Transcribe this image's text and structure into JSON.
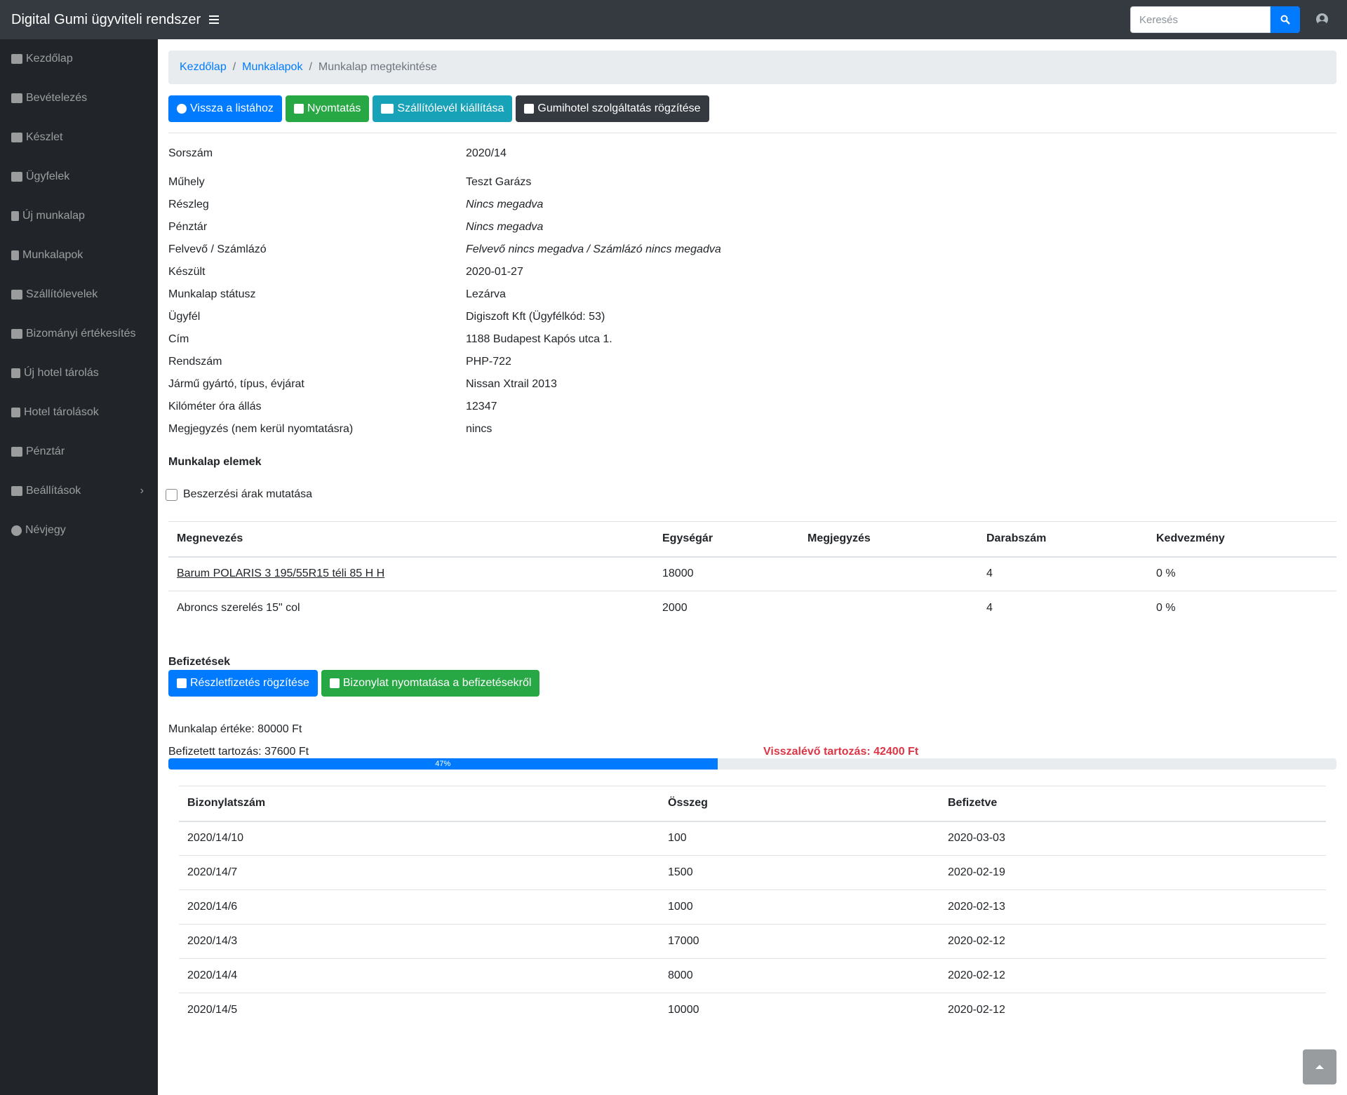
{
  "app": {
    "title": "Digital Gumi ügyviteli rendszer"
  },
  "search": {
    "placeholder": "Keresés"
  },
  "sidebar": {
    "items": [
      {
        "label": "Kezdőlap",
        "icon": "dashboard-icon"
      },
      {
        "label": "Bevételezés",
        "icon": "cubes-icon"
      },
      {
        "label": "Készlet",
        "icon": "warehouse-icon"
      },
      {
        "label": "Ügyfelek",
        "icon": "users-icon"
      },
      {
        "label": "Új munkalap",
        "icon": "file-icon"
      },
      {
        "label": "Munkalapok",
        "icon": "file-text-icon"
      },
      {
        "label": "Szállítólevelek",
        "icon": "truck-loading-icon"
      },
      {
        "label": "Bizományi értékesítés",
        "icon": "handshake-icon"
      },
      {
        "label": "Új hotel tárolás",
        "icon": "hotel-add-icon"
      },
      {
        "label": "Hotel tárolások",
        "icon": "hotel-icon"
      },
      {
        "label": "Pénztár",
        "icon": "cash-register-icon"
      },
      {
        "label": "Beállítások",
        "icon": "wrench-icon"
      },
      {
        "label": "Névjegy",
        "icon": "info-circle-icon"
      }
    ]
  },
  "breadcrumb": {
    "home": "Kezdőlap",
    "list": "Munkalapok",
    "current": "Munkalap megtekintése",
    "separator": "/"
  },
  "actions": {
    "back": "Vissza a listához",
    "print": "Nyomtatás",
    "delivery_note": "Szállítólevél kiállítása",
    "hotel": "Gumihotel szolgáltatás rögzítése"
  },
  "details": [
    {
      "label": "Sorszám",
      "value": "2020/14",
      "italic": false
    },
    {
      "label": "Műhely",
      "value": "Teszt Garázs",
      "italic": false
    },
    {
      "label": "Részleg",
      "value": "Nincs megadva",
      "italic": true
    },
    {
      "label": "Pénztár",
      "value": "Nincs megadva",
      "italic": true
    },
    {
      "label": "Felvevő / Számlázó",
      "value": "Felvevő nincs megadva / Számlázó nincs megadva",
      "italic": true
    },
    {
      "label": "Készült",
      "value": "2020-01-27",
      "italic": false
    },
    {
      "label": "Munkalap státusz",
      "value": "Lezárva",
      "italic": false
    },
    {
      "label": "Ügyfél",
      "value": "Digiszoft Kft (Ügyfélkód: 53)",
      "italic": false
    },
    {
      "label": "Cím",
      "value": "1188 Budapest Kapós utca 1.",
      "italic": false
    },
    {
      "label": "Rendszám",
      "value": "PHP-722",
      "italic": false
    },
    {
      "label": "Jármű gyártó, típus, évjárat",
      "value": "Nissan Xtrail 2013",
      "italic": false
    },
    {
      "label": "Kilóméter óra állás",
      "value": "12347",
      "italic": false
    },
    {
      "label": "Megjegyzés (nem kerül nyomtatásra)",
      "value": "nincs",
      "italic": false
    }
  ],
  "items_section": {
    "title": "Munkalap elemek",
    "checkbox_label": "Beszerzési árak mutatása",
    "columns": [
      "Megnevezés",
      "Egységár",
      "Megjegyzés",
      "Darabszám",
      "Kedvezmény"
    ],
    "rows": [
      {
        "name": "Barum POLARIS 3 195/55R15 téli 85 H H",
        "unit_price": "18000",
        "note": "",
        "qty": "4",
        "discount": "0 %"
      },
      {
        "name": "Abroncs szerelés 15\" col",
        "unit_price": "2000",
        "note": "",
        "qty": "4",
        "discount": "0 %"
      }
    ]
  },
  "payments": {
    "title": "Befizetések",
    "add_button": "Részletfizetés rögzítése",
    "print_button": "Bizonylat nyomtatása a befizetésekről",
    "worksheet_value": "Munkalap értéke: 80000 Ft",
    "paid": "Befizetett tartozás: 37600 Ft",
    "remaining": "Visszalévő tartozás: 42400 Ft",
    "progress_label": "47%",
    "progress_fraction": 0.47,
    "columns": [
      "Bizonylatszám",
      "Összeg",
      "Befizetve"
    ],
    "rows": [
      {
        "number": "2020/14/10",
        "amount": "100",
        "date": "2020-03-03"
      },
      {
        "number": "2020/14/7",
        "amount": "1500",
        "date": "2020-02-19"
      },
      {
        "number": "2020/14/6",
        "amount": "1000",
        "date": "2020-02-13"
      },
      {
        "number": "2020/14/3",
        "amount": "17000",
        "date": "2020-02-12"
      },
      {
        "number": "2020/14/4",
        "amount": "8000",
        "date": "2020-02-12"
      },
      {
        "number": "2020/14/5",
        "amount": "10000",
        "date": "2020-02-12"
      }
    ]
  },
  "colors": {
    "primary": "#007bff",
    "success": "#28a745",
    "info": "#17a2b8",
    "dark": "#343a40",
    "danger": "#dc3545",
    "sidebar": "#212529"
  }
}
